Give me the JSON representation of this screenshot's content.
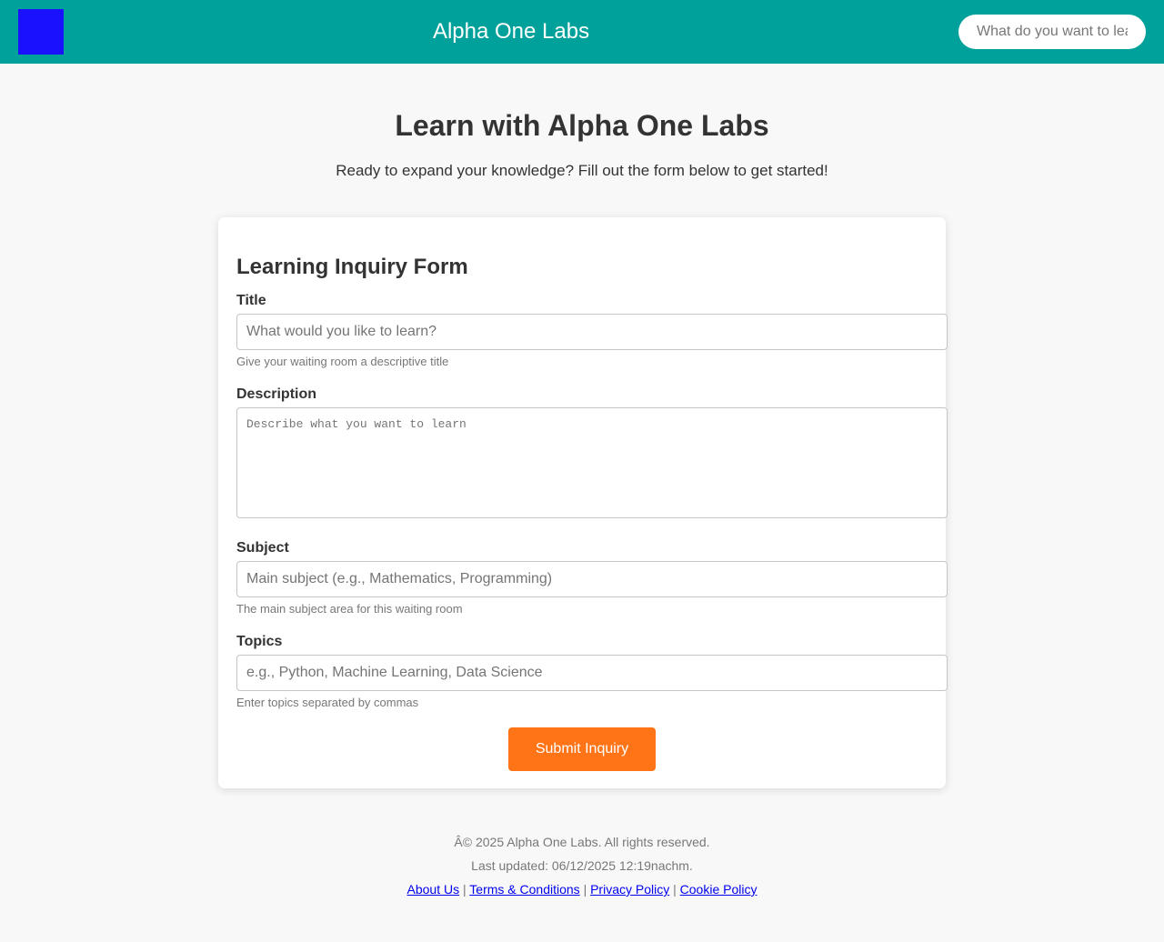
{
  "header": {
    "title": "Alpha One Labs",
    "search_placeholder": "What do you want to learn?",
    "logo_color": "#1a11ff",
    "bar_color": "#00a19a"
  },
  "hero": {
    "title": "Learn with Alpha One Labs",
    "subtitle": "Ready to expand your knowledge? Fill out the form below to get started!"
  },
  "form": {
    "title": "Learning Inquiry Form",
    "fields": {
      "title": {
        "label": "Title",
        "placeholder": "What would you like to learn?",
        "value": "",
        "help": "Give your waiting room a descriptive title"
      },
      "description": {
        "label": "Description",
        "placeholder": "Describe what you want to learn",
        "value": ""
      },
      "subject": {
        "label": "Subject",
        "placeholder": "Main subject (e.g., Mathematics, Programming)",
        "value": "",
        "help": "The main subject area for this waiting room"
      },
      "topics": {
        "label": "Topics",
        "placeholder": "e.g., Python, Machine Learning, Data Science",
        "value": "",
        "help": "Enter topics separated by commas"
      }
    },
    "submit_label": "Submit Inquiry",
    "submit_color": "#ff7417"
  },
  "footer": {
    "copyright": "Â© 2025 Alpha One Labs. All rights reserved.",
    "last_updated": "Last updated: 06/12/2025 12:19nachm.",
    "separator": "|",
    "links": [
      {
        "label": "About Us"
      },
      {
        "label": "Terms & Conditions"
      },
      {
        "label": "Privacy Policy"
      },
      {
        "label": "Cookie Policy"
      }
    ]
  }
}
